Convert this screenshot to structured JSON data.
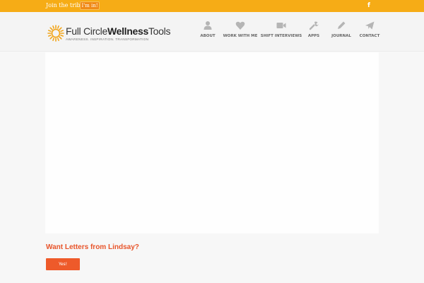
{
  "topbar": {
    "join_text": "Join the tribe.",
    "button_label": "I'm in!",
    "social": [
      "facebook-icon"
    ]
  },
  "header": {
    "brand_light": "Full Circle",
    "brand_bold": "Wellness",
    "brand_light2": "Tools",
    "tagline": "AWARENESS. INSPIRATION. TRANSFORMATION",
    "nav": [
      {
        "label": "ABOUT",
        "icon": "person-icon"
      },
      {
        "label": "WORK WITH ME",
        "icon": "heart-icon"
      },
      {
        "label": "SHIFT INTERVIEWS",
        "icon": "video-camera-icon"
      },
      {
        "label": "APPS",
        "icon": "wrench-icon"
      },
      {
        "label": "JOURNAL",
        "icon": "pencil-icon"
      },
      {
        "label": "CONTACT",
        "icon": "paper-plane-icon"
      }
    ]
  },
  "cta": {
    "heading": "Want Letters from Lindsay?",
    "button_label": "Yes!"
  },
  "colors": {
    "topbar": "#f6ac16",
    "accent": "#ee5a2a",
    "nav_icon": "#b5b5b5"
  }
}
